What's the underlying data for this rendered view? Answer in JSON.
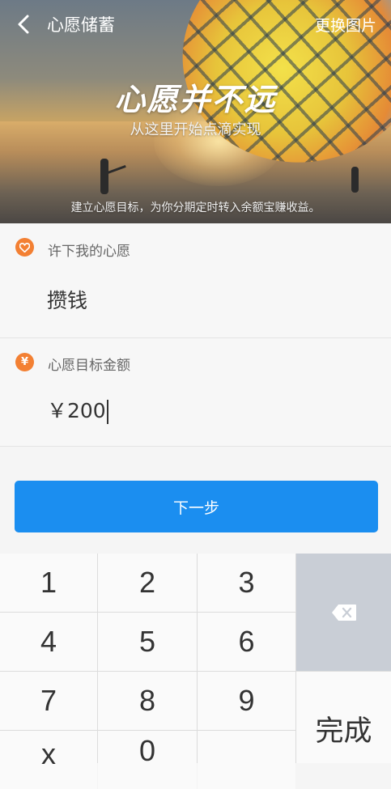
{
  "header": {
    "title": "心愿储蓄",
    "change_image_label": "更换图片"
  },
  "banner": {
    "slogan": "心愿并不远",
    "subtitle": "从这里开始点滴实现",
    "note": "建立心愿目标，为你分期定时转入余额宝赚收益。"
  },
  "wish": {
    "label": "许下我的心愿",
    "value": "攒钱",
    "icon": "heart-icon"
  },
  "amount": {
    "label": "心愿目标金额",
    "value": "￥200",
    "icon": "yen-icon"
  },
  "next_button": "下一步",
  "keypad": {
    "keys": [
      "1",
      "2",
      "3",
      "4",
      "5",
      "6",
      "7",
      "8",
      "9",
      "x",
      "0"
    ],
    "done": "完成",
    "delete_icon": "backspace-icon"
  },
  "colors": {
    "accent": "#1b8ef0",
    "icon_orange": "#f38033",
    "delete_key_bg": "#c9ced6"
  }
}
